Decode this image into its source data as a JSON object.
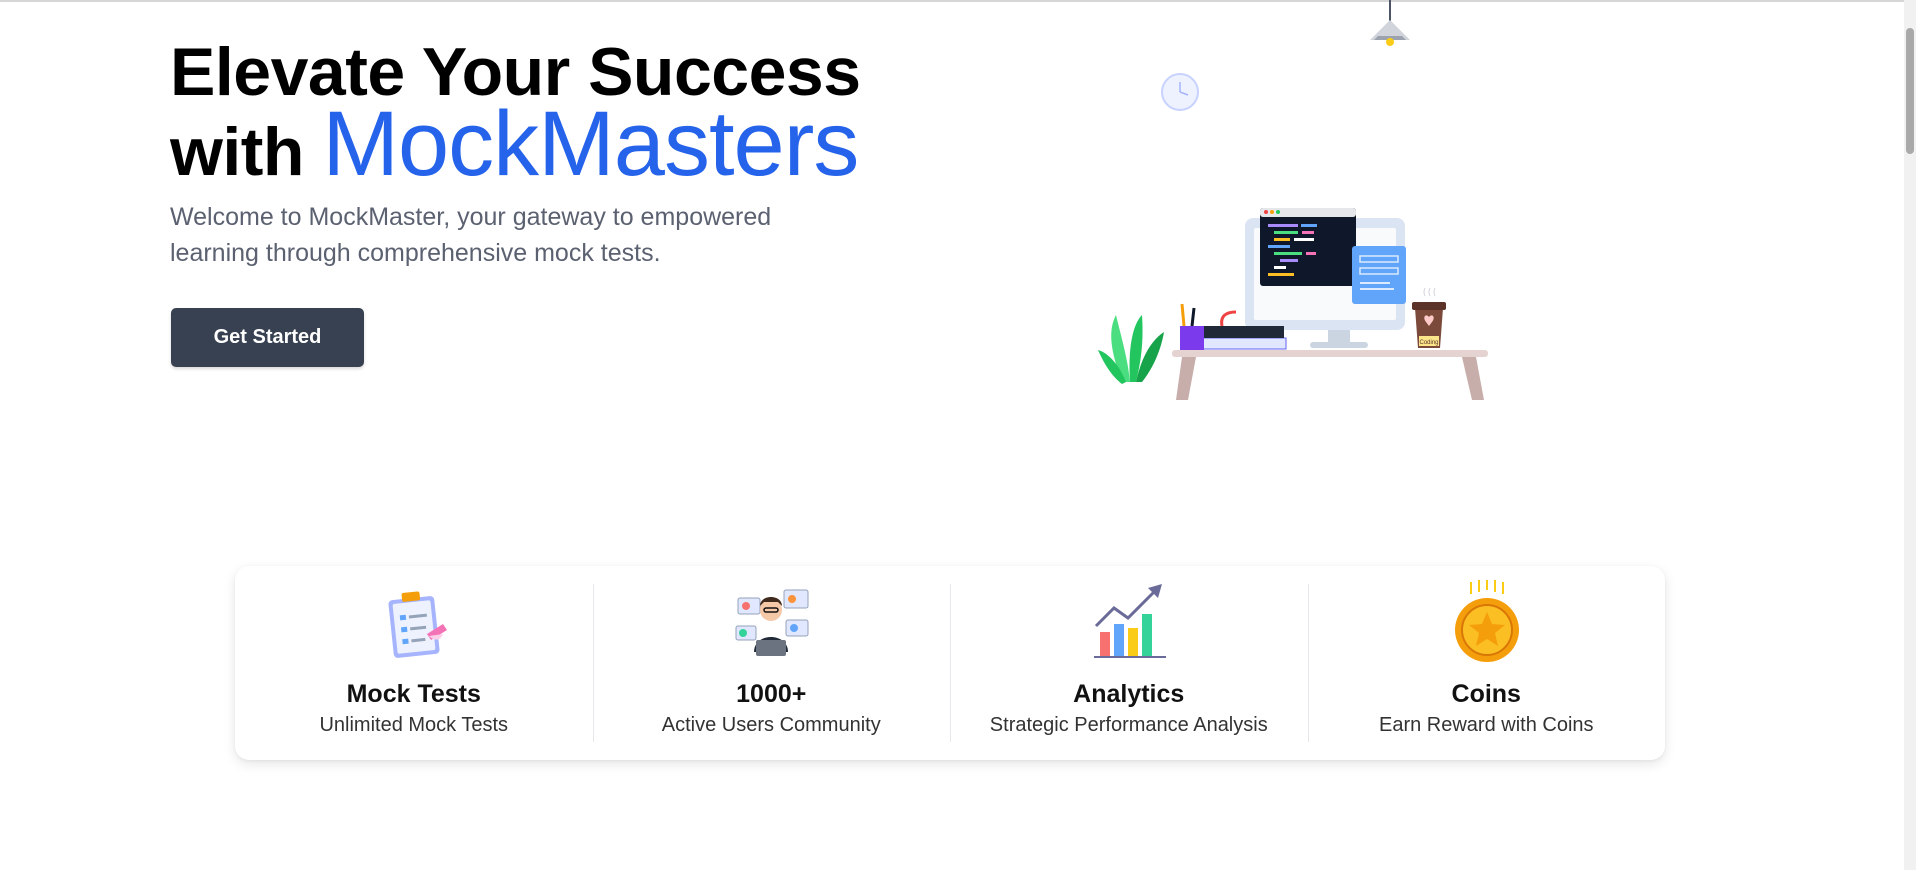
{
  "hero": {
    "title_line1": "Elevate Your Success",
    "title_with": "with ",
    "brand": "MockMasters",
    "subtitle": "Welcome to MockMaster, your gateway to empowered learning through comprehensive mock tests.",
    "cta_label": "Get Started"
  },
  "stats": [
    {
      "title": "Mock Tests",
      "caption": "Unlimited Mock Tests",
      "icon": "clipboard-icon"
    },
    {
      "title": "1000+",
      "caption": "Active Users Community",
      "icon": "community-icon"
    },
    {
      "title": "Analytics",
      "caption": "Strategic Performance Analysis",
      "icon": "growth-chart-icon"
    },
    {
      "title": "Coins",
      "caption": "Earn Reward with Coins",
      "icon": "star-coin-icon"
    }
  ],
  "illustration": {
    "icon": "desk-workspace-illustration",
    "code_label": "Coding"
  },
  "colors": {
    "brand": "#2563eb",
    "cta_bg": "#374151",
    "subtitle": "#5b6170"
  }
}
